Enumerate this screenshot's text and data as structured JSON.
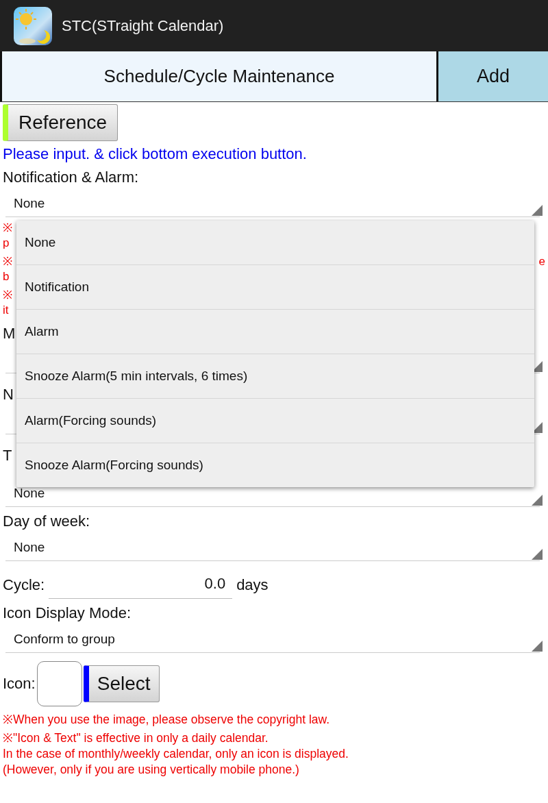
{
  "app_bar": {
    "title": "STC(STraight Calendar)"
  },
  "header": {
    "title": "Schedule/Cycle Maintenance",
    "add_button": "Add"
  },
  "reference_button": "Reference",
  "instruction": "Please input. & click bottom execution button.",
  "notification": {
    "label": "Notification & Alarm:",
    "value": "None"
  },
  "obscured_lines": [
    {
      "kind": "note",
      "left": "※"
    },
    {
      "kind": "note",
      "left": "p"
    },
    {
      "kind": "note",
      "left": "※",
      "right": "e"
    },
    {
      "kind": "note",
      "left": "b"
    },
    {
      "kind": "note",
      "left": "※"
    },
    {
      "kind": "note",
      "left": "it"
    },
    {
      "kind": "label",
      "left": "M"
    },
    {
      "kind": "select"
    },
    {
      "kind": "label",
      "left": "N"
    },
    {
      "kind": "select"
    },
    {
      "kind": "label",
      "left": "T"
    }
  ],
  "partly_hidden_select": {
    "value": "None"
  },
  "day_of_week": {
    "label": "Day of week:",
    "value": "None"
  },
  "cycle": {
    "label": "Cycle:",
    "value": "0.0",
    "unit": "days"
  },
  "icon_display_mode": {
    "label": "Icon Display Mode:",
    "value": "Conform to group"
  },
  "icon": {
    "label": "Icon:",
    "select_button": "Select"
  },
  "notes": [
    "※When you use the image, please observe the copyright law.",
    "※\"Icon & Text\" is effective in only a daily calendar.",
    "In the case of monthly/weekly calendar, only an icon is displayed.",
    "(However, only if you are using vertically mobile phone.)"
  ],
  "dropdown_menu": {
    "options": [
      "None",
      "Notification",
      "Alarm",
      "Snooze Alarm(5 min intervals, 6 times)",
      "Alarm(Forcing sounds)",
      "Snooze Alarm(Forcing sounds)"
    ]
  }
}
